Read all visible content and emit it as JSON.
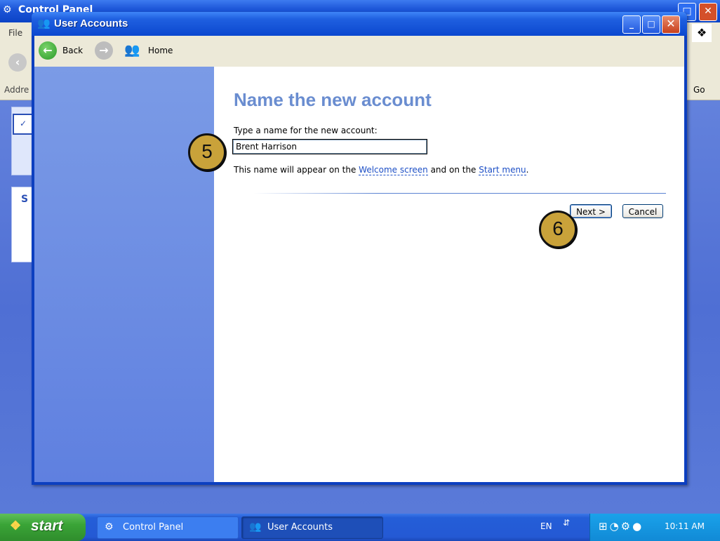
{
  "background_window": {
    "title": "Control Panel",
    "menu_file": "File",
    "address_label": "Addre",
    "go_label": "Go",
    "panel_text": "S"
  },
  "window": {
    "title": "User Accounts",
    "toolbar": {
      "back_label": "Back",
      "home_label": "Home"
    }
  },
  "content": {
    "heading": "Name the new account",
    "prompt": "Type a name for the new account:",
    "name_value": "Brent Harrison",
    "info_prefix": "This name will appear on the ",
    "welcome_link": "Welcome screen",
    "info_middle": " and on the ",
    "start_link": "Start menu",
    "info_suffix": ".",
    "next_label": "Next >",
    "cancel_label": "Cancel"
  },
  "callouts": {
    "step5": "5",
    "step6": "6"
  },
  "taskbar": {
    "start_label": "start",
    "items": [
      {
        "label": "Control Panel"
      },
      {
        "label": "User Accounts"
      }
    ],
    "language": "EN",
    "clock": "10:11 AM"
  },
  "colors": {
    "heading": "#6a8dd0",
    "link": "#1d4fc6",
    "sidebar": "#6f8fe4",
    "titlebar": "#1f5fe0",
    "callout": "#c9a23a"
  }
}
